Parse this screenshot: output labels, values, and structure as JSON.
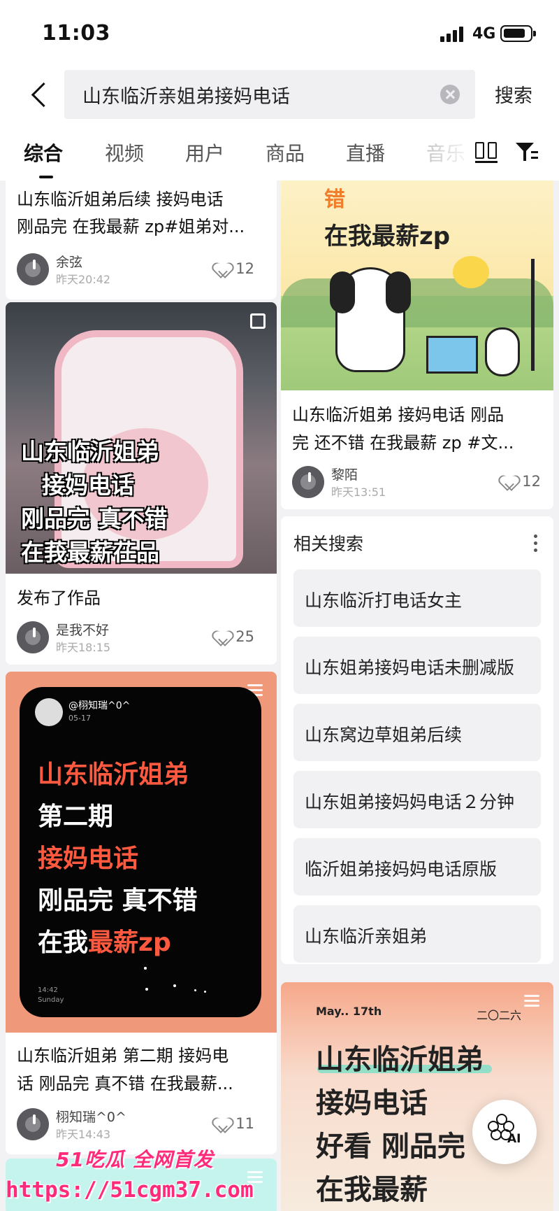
{
  "status": {
    "time": "11:03",
    "network": "4G"
  },
  "search": {
    "query": "山东临沂亲姐弟接妈电话",
    "button": "搜索"
  },
  "tabs": [
    "综合",
    "视频",
    "用户",
    "商品",
    "直播",
    "音乐"
  ],
  "cards": [
    {
      "title_line1": "山东临沂姐弟后续 接妈电话",
      "title_line2": "刚品完 在我最薪 zp#姐弟对...",
      "author": "余弦",
      "time": "昨天20:42",
      "likes": "12"
    },
    {
      "overlay": [
        "山东临沂姐弟",
        "接妈电话",
        "刚品完 真不错",
        "在莪最薪茌品"
      ],
      "title_line1": "发布了作品",
      "author": "是我不好",
      "time": "昨天18:15",
      "likes": "25"
    },
    {
      "poster_user": "@栩知瑞^0^",
      "poster_date": "05-17",
      "poster_lines": [
        "山东临沂姐弟",
        "第二期",
        "接妈电话",
        "刚品完  真不错",
        "在我",
        "最薪zp"
      ],
      "poster_clock": "14:42",
      "poster_day": "Sunday",
      "title_line1": "山东临沂姐弟 第二期 接妈电",
      "title_line2": "话  刚品完 真不错 在我最薪...",
      "author": "栩知瑞^0^",
      "time": "昨天14:43",
      "likes": "11"
    },
    {
      "overlay": [
        "错",
        "在我最薪zp"
      ],
      "title_line1": "山东临沂姐弟 接妈电话 刚品",
      "title_line2": "完 还不错 在我最薪 zp #文...",
      "author": "黎陌",
      "time": "昨天13:51",
      "likes": "12"
    },
    {
      "poster_date": "May.. 17th",
      "poster_year": "二〇二六",
      "overlay": [
        "山东临沂姐弟",
        "接妈电话",
        "好看  刚品完",
        "在我最薪"
      ]
    }
  ],
  "related": {
    "title": "相关搜索",
    "items": [
      "山东临沂打电话女主",
      "山东姐弟接妈电话未删减版",
      "山东窝边草姐弟后续",
      "山东姐弟接妈妈电话２分钟",
      "临沂姐弟接妈妈电话原版",
      "山东临沂亲姐弟"
    ]
  },
  "ai_label": "AI",
  "watermark": {
    "brand": "51吃瓜 全网首发",
    "url": "https://51cgm37.com"
  }
}
